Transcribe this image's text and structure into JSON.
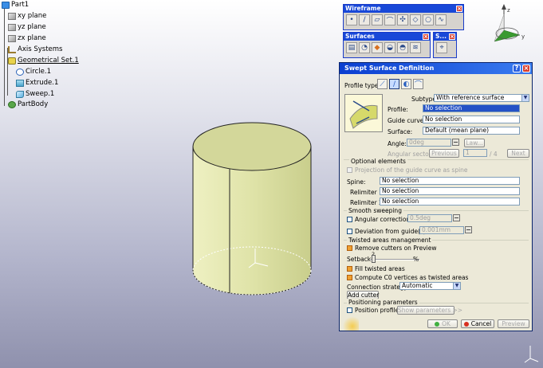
{
  "tree": {
    "root": "Part1",
    "items": [
      {
        "label": "xy plane",
        "icon": "plane-icon"
      },
      {
        "label": "yz plane",
        "icon": "plane-icon"
      },
      {
        "label": "zx plane",
        "icon": "plane-icon"
      },
      {
        "label": "Axis Systems",
        "icon": "axis-system-icon"
      },
      {
        "label": "Geometrical Set.1",
        "icon": "geometrical-set-icon"
      },
      {
        "label": "Circle.1",
        "icon": "circle-icon"
      },
      {
        "label": "Extrude.1",
        "icon": "extrude-icon"
      },
      {
        "label": "Sweep.1",
        "icon": "sweep-icon"
      },
      {
        "label": "PartBody",
        "icon": "part-body-icon"
      }
    ]
  },
  "toolbars": {
    "wireframe": {
      "title": "Wireframe"
    },
    "surfaces": {
      "title": "Surfaces"
    },
    "small": {
      "title": "S..."
    }
  },
  "dialog": {
    "title": "Swept Surface Definition",
    "profile_type_label": "Profile type:",
    "subtype_label": "Subtype:",
    "subtype_value": "With reference surface",
    "profile_label": "Profile:",
    "profile_value": "No selection",
    "guide_curve_label": "Guide curve:",
    "guide_curve_value": "No selection",
    "surface_label": "Surface:",
    "surface_value": "Default (mean plane)",
    "angle_label": "Angle:",
    "angle_value": "0deg",
    "law_button": "Law...",
    "angular_sector_label": "Angular sector:",
    "previous_button": "Previous",
    "sector_value": "1",
    "sector_total": "/ 4",
    "next_button": "Next",
    "optional_elements_header": "Optional elements",
    "projection_label": "Projection of the guide curve as spine",
    "spine_label": "Spine:",
    "spine_value": "No selection",
    "relimiter1_label": "Relimiter 1:",
    "relimiter1_value": "No selection",
    "relimiter2_label": "Relimiter 2:",
    "relimiter2_value": "No selection",
    "smooth_sweeping_header": "Smooth sweeping",
    "angular_correction_label": "Angular correction:",
    "angular_correction_value": "0.5deg",
    "deviation_label": "Deviation from guide(s):",
    "deviation_value": "0.001mm",
    "twisted_header": "Twisted areas management",
    "remove_cutters_label": "Remove cutters on Preview",
    "setback_label": "Setback",
    "setback_value": "2",
    "setback_unit": "%",
    "fill_twisted_label": "Fill twisted areas",
    "compute_c0_label": "Compute C0 vertices as twisted areas",
    "connection_strategy_label": "Connection strategy:",
    "connection_strategy_value": "Automatic",
    "add_cutter_button": "Add cutter",
    "positioning_header": "Positioning parameters",
    "position_profile_label": "Position profile",
    "show_parameters_button": "Show parameters >>",
    "ok_button": "OK",
    "cancel_button": "Cancel",
    "preview_button": "Preview"
  },
  "compass": {
    "axis_z": "z",
    "axis_x": "x",
    "axis_y": "y"
  },
  "colors": {
    "accent": "#1848d8",
    "surface": "#dfe3a8",
    "background_top": "#ffffff",
    "background_bottom": "#8f91ad"
  }
}
